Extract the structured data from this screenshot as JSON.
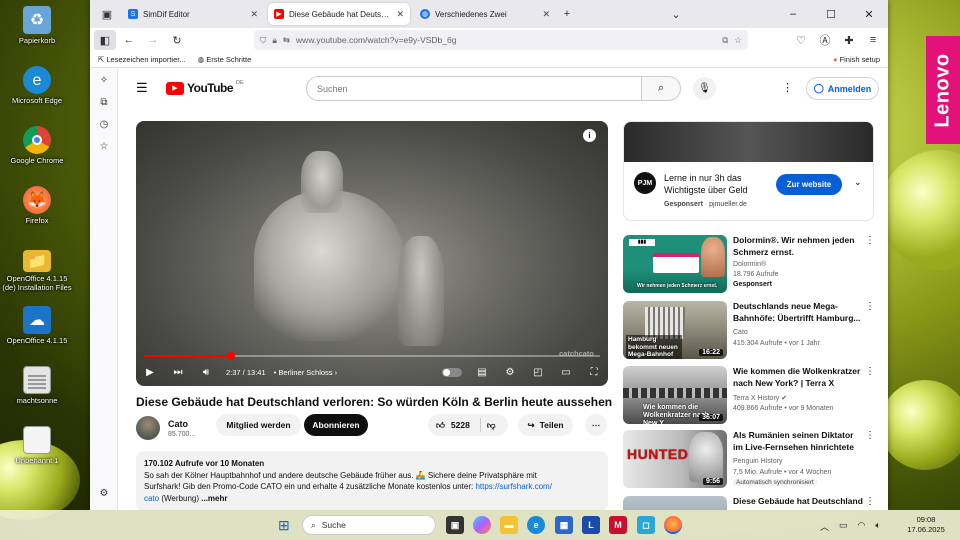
{
  "desktop": {
    "icons": [
      {
        "label": "Papierkorb",
        "icon": "recycle-bin-icon",
        "color": "#6aa5d8"
      },
      {
        "label": "Microsoft Edge",
        "icon": "edge-icon",
        "color": "#1a8ad4"
      },
      {
        "label": "Google Chrome",
        "icon": "chrome-icon",
        "color": "#db4437"
      },
      {
        "label": "Firefox",
        "icon": "firefox-icon",
        "color": "#ff7139"
      },
      {
        "label": "OpenOffice 4.1.15 (de) Installation Files",
        "icon": "folder-icon",
        "color": "#e8b830"
      },
      {
        "label": "OpenOffice 4.1.15",
        "icon": "openoffice-icon",
        "color": "#1c74c8"
      },
      {
        "label": "machtsonne",
        "icon": "document-icon",
        "color": "#dddddd"
      },
      {
        "label": "Unbenannt 1",
        "icon": "document-icon",
        "color": "#f4f4f4"
      }
    ]
  },
  "browser": {
    "tabs": [
      {
        "label": "SimDif Editor",
        "favicon_color": "#1a73e8"
      },
      {
        "label": "Diese Gebäude hat Deutschland",
        "favicon_color": "#ff0000",
        "active": true
      },
      {
        "label": "Verschiedenes Zwei",
        "favicon_color": "#1a73e8"
      }
    ],
    "new_tab": "+",
    "url": "www.youtube.com/watch?v=e9y-VSDb_6g",
    "bookmarks": [
      "Lesezeichen importier...",
      "Erste Schritte"
    ],
    "bookmark_right": "Finish setup"
  },
  "youtube": {
    "logo_text": "YouTube",
    "region": "DE",
    "search_placeholder": "Suchen",
    "signin_label": "Anmelden",
    "player": {
      "current_time": "2:37",
      "total_time": "13:41",
      "time_display": "2:37 / 13:41",
      "chapter": "Berliner Schloss",
      "progress": 0.191,
      "watermark": "catchcato"
    },
    "video_title": "Diese Gebäude hat Deutschland verloren: So würden Köln & Berlin heute aussehen",
    "channel": {
      "name": "Cato",
      "subscribers": "85.700..."
    },
    "join_label": "Mitglied werden",
    "subscribe_label": "Abonnieren",
    "likes": "5228",
    "share_label": "Teilen",
    "description": {
      "stats": "170.102 Aufrufe  vor 10 Monaten",
      "line1": "So sah der Kölner Hauptbahnhof und andere deutsche Gebäude früher aus. 🚣 Sichere deine Privatsphäre mit",
      "line2": "Surfshark! Gib den Promo-Code CATO ein und erhalte 4 zusätzliche Monate kostenlos unter:",
      "link": "https://surfshark.com/",
      "line3a": "cato",
      "line3b": "(Werbung)",
      "more": "...mehr"
    },
    "ad": {
      "title": "Lerne in nur 3h das Wichtigste über Geld",
      "sponsored": "Gesponsert",
      "domain": "pjmueller.de",
      "button": "Zur website"
    },
    "recommendations": [
      {
        "title": "Dolormin®. Wir nehmen jeden Schmerz ernst.",
        "channel": "Dolormin®",
        "meta": "18.796 Aufrufe",
        "badge": "Gesponsert",
        "duration": "",
        "thumb_caption": "Wir nehmen jeden Schmerz ernst."
      },
      {
        "title": "Deutschlands neue Mega-Bahnhöfe: Übertrifft Hamburg...",
        "channel": "Cato",
        "meta": "415.304 Aufrufe  •  vor 1 Jahr",
        "duration": "16:22",
        "thumb_caption": "Hamburg bekommt neuen Mega-Bahnhof"
      },
      {
        "title": "Wie kommen die Wolkenkratzer nach New York? | Terra X",
        "channel": "Terra X History ✔",
        "meta": "409.866 Aufrufe  •  vor 9 Monaten",
        "duration": "36:07",
        "thumb_caption": "Wie kommen die Wolkenkratzer nach New Y"
      },
      {
        "title": "Als Rumänien seinen Diktator im Live-Fernsehen hinrichtete",
        "channel": "Penguin History",
        "meta": "7,5 Mio. Aufrufe  •  vor 4 Wochen",
        "badge": "Automatisch synchronisiert",
        "duration": "9:56",
        "thumb_caption": "HUNTED"
      },
      {
        "title": "Diese Gebäude hat Deutschland",
        "channel": "",
        "meta": "",
        "duration": "",
        "thumb_caption": ""
      }
    ]
  },
  "brand_badge": "Lenovo",
  "taskbar": {
    "search_placeholder": "Suche",
    "time": "09:08",
    "date": "17.06.2025"
  },
  "colors": {
    "youtube_red": "#ff0000",
    "link_blue": "#065fd4",
    "lenovo_pink": "#e2127a"
  }
}
